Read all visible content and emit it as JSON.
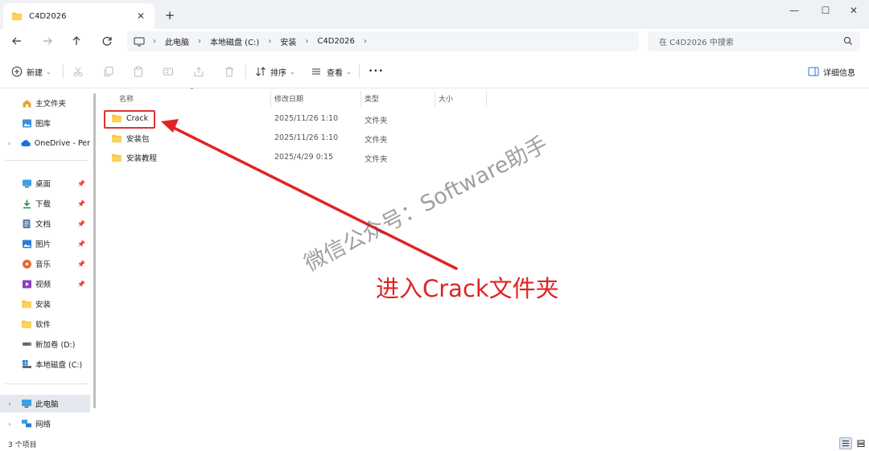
{
  "window": {
    "tab_title": "C4D2026",
    "new_tab": "+",
    "minimize": "—",
    "maximize": "☐",
    "close": "✕"
  },
  "nav": {
    "breadcrumbs": [
      "此电脑",
      "本地磁盘 (C:)",
      "安装",
      "C4D2026"
    ],
    "search_placeholder": "在 C4D2026 中搜索"
  },
  "toolbar": {
    "new_label": "新建",
    "sort_label": "排序",
    "view_label": "查看",
    "more_label": "•••",
    "details_label": "详细信息"
  },
  "sidebar": {
    "quick": [
      {
        "label": "主文件夹",
        "icon": "home-icon"
      },
      {
        "label": "图库",
        "icon": "gallery-icon"
      },
      {
        "label": "OneDrive - Per",
        "icon": "cloud-icon"
      }
    ],
    "pinned": [
      {
        "label": "桌面",
        "icon": "desktop-icon"
      },
      {
        "label": "下载",
        "icon": "download-icon"
      },
      {
        "label": "文档",
        "icon": "document-icon"
      },
      {
        "label": "图片",
        "icon": "picture-icon"
      },
      {
        "label": "音乐",
        "icon": "music-icon"
      },
      {
        "label": "视频",
        "icon": "video-icon"
      },
      {
        "label": "安装",
        "icon": "folder-icon"
      },
      {
        "label": "软件",
        "icon": "folder-icon"
      },
      {
        "label": "新加卷 (D:)",
        "icon": "drive-icon"
      },
      {
        "label": "本地磁盘 (C:)",
        "icon": "system-drive-icon"
      }
    ],
    "devices": [
      {
        "label": "此电脑",
        "icon": "computer-icon"
      },
      {
        "label": "网络",
        "icon": "network-icon"
      }
    ]
  },
  "columns": {
    "name": "名称",
    "date": "修改日期",
    "type": "类型",
    "size": "大小"
  },
  "files": [
    {
      "name": "Crack",
      "date": "2025/11/26 1:10",
      "type": "文件夹"
    },
    {
      "name": "安装包",
      "date": "2025/11/26 1:10",
      "type": "文件夹"
    },
    {
      "name": "安装教程",
      "date": "2025/4/29 0:15",
      "type": "文件夹"
    }
  ],
  "status": {
    "count": "3 个项目"
  },
  "overlay": {
    "watermark": "微信公众号：Software助手",
    "annotation": "进入Crack文件夹"
  },
  "colors": {
    "folder": "#f5c142",
    "annotation": "#e02424",
    "accent": "#2f6fd6"
  }
}
